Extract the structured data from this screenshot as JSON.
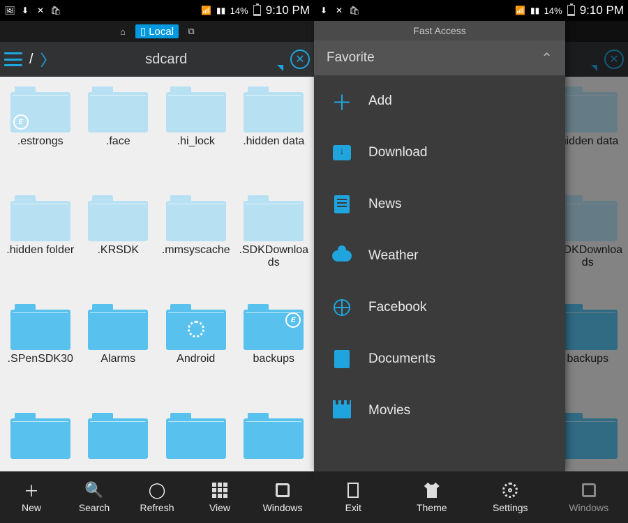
{
  "status": {
    "battery": "14%",
    "time": "9:10 PM"
  },
  "tabs": {
    "local": "Local"
  },
  "path": {
    "root": "/",
    "current": "sdcard"
  },
  "folders": [
    ".estrongs",
    ".face",
    ".hi_lock",
    ".hidden data",
    ".hidden folder",
    ".KRSDK",
    ".mmsyscache",
    ".SDKDownloads",
    ".SPenSDK30",
    "Alarms",
    "Android",
    "backups",
    "",
    "",
    "",
    ""
  ],
  "toolbar": [
    "New",
    "Search",
    "Refresh",
    "View",
    "Windows"
  ],
  "panel": {
    "title": "Fast Access",
    "section": "Favorite",
    "items": [
      "Add",
      "Download",
      "News",
      "Weather",
      "Facebook",
      "Documents",
      "Movies"
    ]
  },
  "toolbar2": [
    "Exit",
    "Theme",
    "Settings",
    "Windows"
  ]
}
